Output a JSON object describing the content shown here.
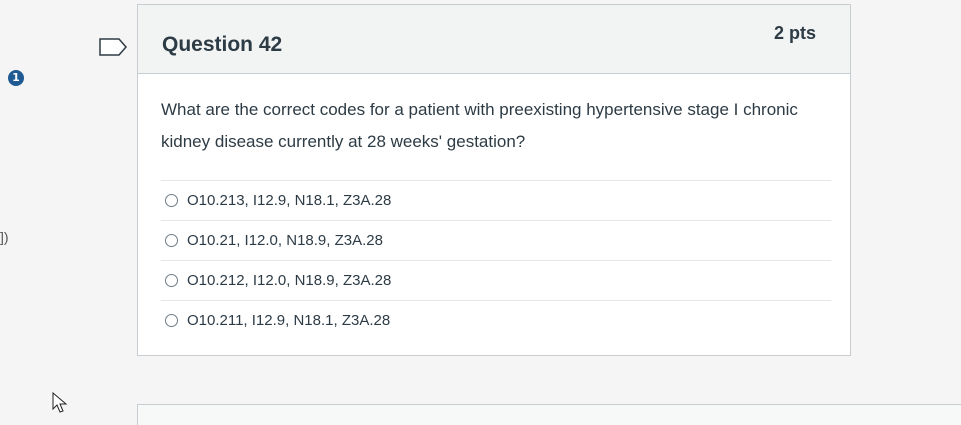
{
  "question": {
    "title": "Question 42",
    "points": "2 pts",
    "text": "What are the correct codes for a patient with preexisting hypertensive stage I chronic kidney disease currently at 28 weeks' gestation?",
    "answers": [
      "O10.213, I12.9, N18.1, Z3A.28",
      "O10.21, I12.0, N18.9, Z3A.28",
      "O10.212, I12.0, N18.9, Z3A.28",
      "O10.211, I12.9, N18.1, Z3A.28"
    ]
  },
  "side": {
    "info_badge": "1",
    "edge_mark": "])"
  },
  "icons": {
    "flag": "flag-question-icon",
    "cursor": "mouse-pointer-icon",
    "info": "info-badge-icon"
  },
  "colors": {
    "badge": "#1f5a93",
    "text": "#2d3b45",
    "border": "#c7cdd1"
  }
}
